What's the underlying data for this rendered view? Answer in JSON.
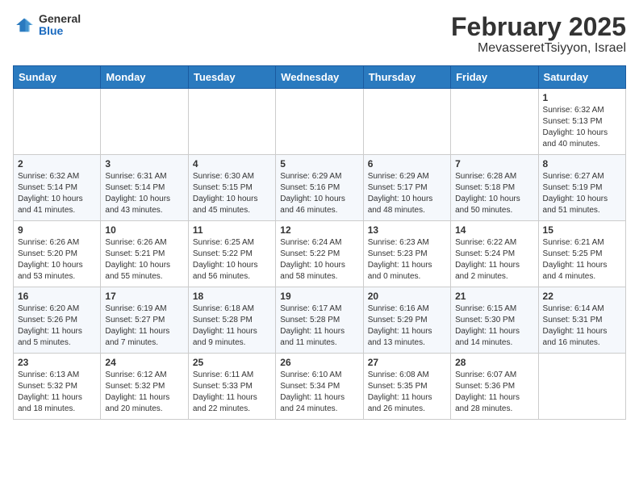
{
  "header": {
    "logo_general": "General",
    "logo_blue": "Blue",
    "title": "February 2025",
    "subtitle": "MevasseretTsiyyon, Israel"
  },
  "weekdays": [
    "Sunday",
    "Monday",
    "Tuesday",
    "Wednesday",
    "Thursday",
    "Friday",
    "Saturday"
  ],
  "weeks": [
    [
      {
        "day": "",
        "info": ""
      },
      {
        "day": "",
        "info": ""
      },
      {
        "day": "",
        "info": ""
      },
      {
        "day": "",
        "info": ""
      },
      {
        "day": "",
        "info": ""
      },
      {
        "day": "",
        "info": ""
      },
      {
        "day": "1",
        "info": "Sunrise: 6:32 AM\nSunset: 5:13 PM\nDaylight: 10 hours and 40 minutes."
      }
    ],
    [
      {
        "day": "2",
        "info": "Sunrise: 6:32 AM\nSunset: 5:14 PM\nDaylight: 10 hours and 41 minutes."
      },
      {
        "day": "3",
        "info": "Sunrise: 6:31 AM\nSunset: 5:14 PM\nDaylight: 10 hours and 43 minutes."
      },
      {
        "day": "4",
        "info": "Sunrise: 6:30 AM\nSunset: 5:15 PM\nDaylight: 10 hours and 45 minutes."
      },
      {
        "day": "5",
        "info": "Sunrise: 6:29 AM\nSunset: 5:16 PM\nDaylight: 10 hours and 46 minutes."
      },
      {
        "day": "6",
        "info": "Sunrise: 6:29 AM\nSunset: 5:17 PM\nDaylight: 10 hours and 48 minutes."
      },
      {
        "day": "7",
        "info": "Sunrise: 6:28 AM\nSunset: 5:18 PM\nDaylight: 10 hours and 50 minutes."
      },
      {
        "day": "8",
        "info": "Sunrise: 6:27 AM\nSunset: 5:19 PM\nDaylight: 10 hours and 51 minutes."
      }
    ],
    [
      {
        "day": "9",
        "info": "Sunrise: 6:26 AM\nSunset: 5:20 PM\nDaylight: 10 hours and 53 minutes."
      },
      {
        "day": "10",
        "info": "Sunrise: 6:26 AM\nSunset: 5:21 PM\nDaylight: 10 hours and 55 minutes."
      },
      {
        "day": "11",
        "info": "Sunrise: 6:25 AM\nSunset: 5:22 PM\nDaylight: 10 hours and 56 minutes."
      },
      {
        "day": "12",
        "info": "Sunrise: 6:24 AM\nSunset: 5:22 PM\nDaylight: 10 hours and 58 minutes."
      },
      {
        "day": "13",
        "info": "Sunrise: 6:23 AM\nSunset: 5:23 PM\nDaylight: 11 hours and 0 minutes."
      },
      {
        "day": "14",
        "info": "Sunrise: 6:22 AM\nSunset: 5:24 PM\nDaylight: 11 hours and 2 minutes."
      },
      {
        "day": "15",
        "info": "Sunrise: 6:21 AM\nSunset: 5:25 PM\nDaylight: 11 hours and 4 minutes."
      }
    ],
    [
      {
        "day": "16",
        "info": "Sunrise: 6:20 AM\nSunset: 5:26 PM\nDaylight: 11 hours and 5 minutes."
      },
      {
        "day": "17",
        "info": "Sunrise: 6:19 AM\nSunset: 5:27 PM\nDaylight: 11 hours and 7 minutes."
      },
      {
        "day": "18",
        "info": "Sunrise: 6:18 AM\nSunset: 5:28 PM\nDaylight: 11 hours and 9 minutes."
      },
      {
        "day": "19",
        "info": "Sunrise: 6:17 AM\nSunset: 5:28 PM\nDaylight: 11 hours and 11 minutes."
      },
      {
        "day": "20",
        "info": "Sunrise: 6:16 AM\nSunset: 5:29 PM\nDaylight: 11 hours and 13 minutes."
      },
      {
        "day": "21",
        "info": "Sunrise: 6:15 AM\nSunset: 5:30 PM\nDaylight: 11 hours and 14 minutes."
      },
      {
        "day": "22",
        "info": "Sunrise: 6:14 AM\nSunset: 5:31 PM\nDaylight: 11 hours and 16 minutes."
      }
    ],
    [
      {
        "day": "23",
        "info": "Sunrise: 6:13 AM\nSunset: 5:32 PM\nDaylight: 11 hours and 18 minutes."
      },
      {
        "day": "24",
        "info": "Sunrise: 6:12 AM\nSunset: 5:32 PM\nDaylight: 11 hours and 20 minutes."
      },
      {
        "day": "25",
        "info": "Sunrise: 6:11 AM\nSunset: 5:33 PM\nDaylight: 11 hours and 22 minutes."
      },
      {
        "day": "26",
        "info": "Sunrise: 6:10 AM\nSunset: 5:34 PM\nDaylight: 11 hours and 24 minutes."
      },
      {
        "day": "27",
        "info": "Sunrise: 6:08 AM\nSunset: 5:35 PM\nDaylight: 11 hours and 26 minutes."
      },
      {
        "day": "28",
        "info": "Sunrise: 6:07 AM\nSunset: 5:36 PM\nDaylight: 11 hours and 28 minutes."
      },
      {
        "day": "",
        "info": ""
      }
    ]
  ]
}
